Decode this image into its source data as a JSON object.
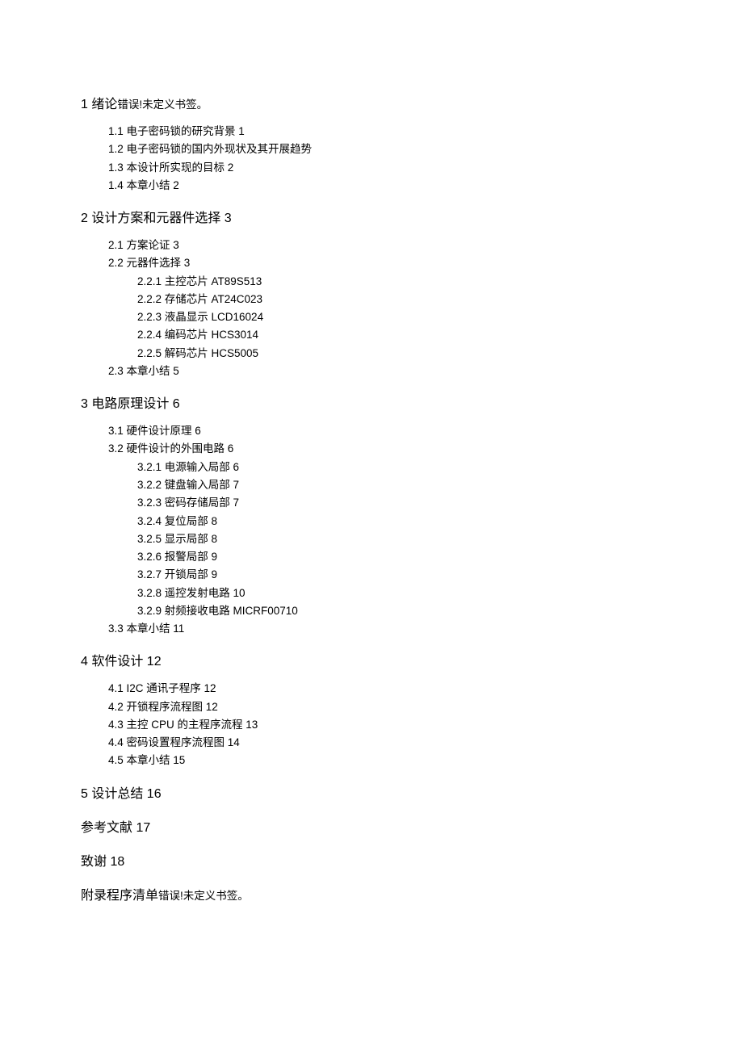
{
  "toc": {
    "s1": {
      "num": "1",
      "title": "绪论",
      "err": "错误!未定义书签。",
      "i1": "1.1  电子密码锁的研究背景 1",
      "i2": "1.2  电子密码锁的国内外现状及其开展趋势",
      "i3": "1.3  本设计所实现的目标 2",
      "i4": "1.4  本章小结 2"
    },
    "s2": {
      "num": "2",
      "title": " 设计方案和元器件选择 3",
      "i1": "2.1  方案论证 3",
      "i2": "2.2  元器件选择 3",
      "i2_1": "2.2.1 主控芯片 AT89S513",
      "i2_2": "2.2.2  存储芯片 AT24C023",
      "i2_3": "2.2.3  液晶显示 LCD16024",
      "i2_4": "2.2.4  编码芯片 HCS3014",
      "i2_5": "2.2.5  解码芯片 HCS5005",
      "i3": "2.3  本章小结 5"
    },
    "s3": {
      "num": "3",
      "title": " 电路原理设计 6",
      "i1": "3.1  硬件设计原理 6",
      "i2": "3.2  硬件设计的外围电路 6",
      "i2_1": "3.2.1  电源输入局部 6",
      "i2_2": "3.2.2  键盘输入局部 7",
      "i2_3": "3.2.3  密码存储局部 7",
      "i2_4": "3.2.4  复位局部 8",
      "i2_5": "3.2.5  显示局部 8",
      "i2_6": "3.2.6  报警局部 9",
      "i2_7": "3.2.7  开锁局部 9",
      "i2_8": "3.2.8  遥控发射电路 10",
      "i2_9": "3.2.9  射频接收电路 MICRF00710",
      "i3": "3.3  本章小结 11"
    },
    "s4": {
      "num": "4",
      "title": " 软件设计 12",
      "i1": "4.1  I2C 通讯子程序 12",
      "i2": "4.2  开锁程序流程图 12",
      "i3": "4.3  主控 CPU 的主程序流程 13",
      "i4": "4.4  密码设置程序流程图 14",
      "i5": "4.5  本章小结 15"
    },
    "s5": {
      "num": "5",
      "title": " 设计总结 16"
    },
    "ref": "参考文献 17",
    "ack": "致谢 18",
    "app": {
      "title": "附录程序清单",
      "err": "错误!未定义书签。"
    }
  }
}
